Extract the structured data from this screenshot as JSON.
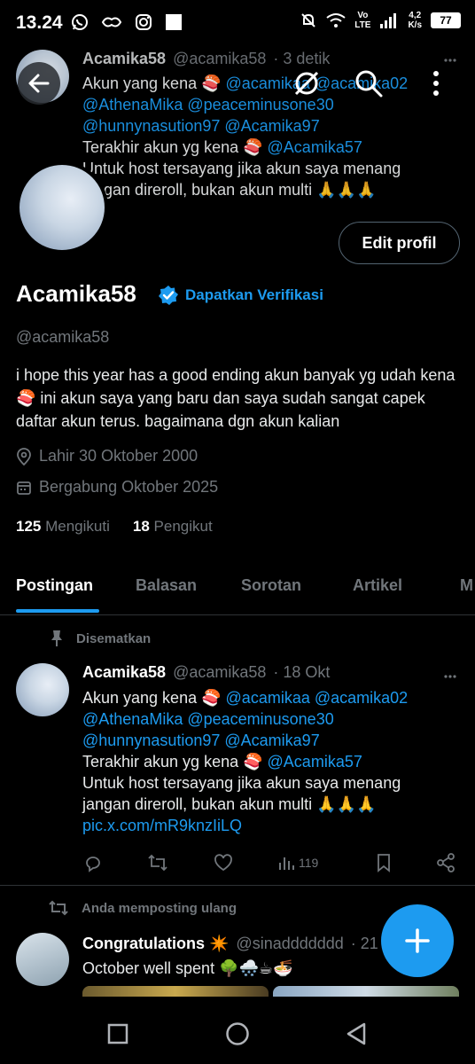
{
  "status_bar": {
    "time": "13.24",
    "net_speed_value": "4,2",
    "net_speed_unit": "K/s",
    "lte_label_top": "Vo",
    "lte_label_bottom": "LTE",
    "battery": "77"
  },
  "background_tweet": {
    "name": "Acamika58",
    "handle": "@acamika58",
    "time": "· 3 detik",
    "line1_prefix": "Akun yang kena 🍣",
    "line1_mentions": "@acamikaa @acamika02",
    "line2": "@AthenaMika @peaceminusone30",
    "line3": "@hunnynasution97 @Acamika97",
    "line4_prefix": "Terakhir akun yg kena 🍣",
    "line4_mention": "@Acamika57",
    "line5": "Untuk host tersayang jika akun saya menang",
    "line6": "jangan direroll, bukan akun multi 🙏🙏🙏"
  },
  "profile": {
    "edit_button": "Edit profil",
    "display_name": "Acamika58",
    "verification_cta": "Dapatkan Verifikasi",
    "handle": "@acamika58",
    "bio": "i hope this year has a good ending  akun banyak yg udah kena 🍣 ini akun saya yang baru dan saya sudah sangat capek daftar akun terus. bagaimana dgn akun kalian",
    "birthday": "Lahir 30 Oktober 2000",
    "joined": "Bergabung Oktober 2025",
    "following_count": "125",
    "following_label": "Mengikuti",
    "followers_count": "18",
    "followers_label": "Pengikut"
  },
  "tabs": [
    {
      "label": "Postingan"
    },
    {
      "label": "Balasan"
    },
    {
      "label": "Sorotan"
    },
    {
      "label": "Artikel"
    },
    {
      "label": "M"
    }
  ],
  "pinned_tweet": {
    "pinned_label": "Disematkan",
    "name": "Acamika58",
    "handle": "@acamika58",
    "time": "· 18 Okt",
    "line1_prefix": "Akun yang kena 🍣",
    "line1_mentions": "@acamikaa @acamika02",
    "line2": "@AthenaMika @peaceminusone30",
    "line3": "@hunnynasution97 @Acamika97",
    "line4_prefix": "Terakhir akun yg kena 🍣",
    "line4_mention": "@Acamika57",
    "line5": "Untuk host tersayang jika akun saya menang",
    "line6": "jangan direroll, bukan akun multi 🙏🙏🙏",
    "link": "pic.x.com/mR9knzIiLQ",
    "views": "119"
  },
  "repost": {
    "label": "Anda memposting ulang",
    "name": "Congratulations ✴️",
    "handle": "@sinaddddddd",
    "time": "· 21",
    "text": "October well spent 🌳🌨️☕🍜"
  },
  "colors": {
    "accent": "#1d9bf0",
    "muted": "#71767b",
    "background": "#000000"
  }
}
